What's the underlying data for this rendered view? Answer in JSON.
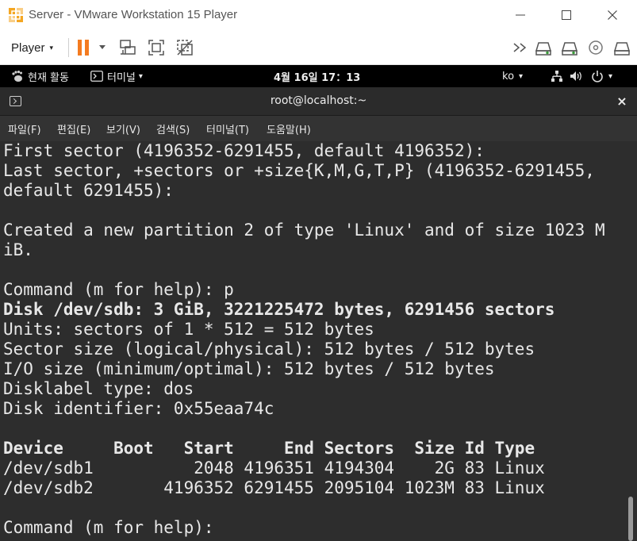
{
  "window": {
    "title": "Server - VMware Workstation 15 Player",
    "minimize_symbol": "—",
    "maximize_symbol": "☐",
    "close_symbol": "✕"
  },
  "toolbar": {
    "player_label": "Player",
    "caret": "▾",
    "icons": [
      "pause-icon",
      "send-ctrl-alt-del-icon",
      "fullscreen-icon",
      "unity-icon",
      "forward-icon",
      "hdd-icon",
      "network-icon",
      "cd-icon",
      "usb-icon"
    ]
  },
  "gnome": {
    "activities": "현재 활동",
    "terminal_menu": "터미널",
    "clock": "4월 16일  17：13",
    "input_method": "ko",
    "caret": "▾"
  },
  "terminal": {
    "title": "root@localhost:~",
    "close_symbol": "×",
    "menu": [
      "파일(F)",
      "편집(E)",
      "보기(V)",
      "검색(S)",
      "터미널(T)",
      "도움말(H)"
    ],
    "lines": [
      {
        "text": "First sector (4196352-6291455, default 4196352):",
        "bold": false
      },
      {
        "text": "Last sector, +sectors or +size{K,M,G,T,P} (4196352-6291455,",
        "bold": false
      },
      {
        "text": "default 6291455):",
        "bold": false
      },
      {
        "text": "",
        "bold": false
      },
      {
        "text": "Created a new partition 2 of type 'Linux' and of size 1023 M",
        "bold": false
      },
      {
        "text": "iB.",
        "bold": false
      },
      {
        "text": "",
        "bold": false
      },
      {
        "text": "Command (m for help): p",
        "bold": false
      },
      {
        "text": "Disk /dev/sdb: 3 GiB, 3221225472 bytes, 6291456 sectors",
        "bold": true
      },
      {
        "text": "Units: sectors of 1 * 512 = 512 bytes",
        "bold": false
      },
      {
        "text": "Sector size (logical/physical): 512 bytes / 512 bytes",
        "bold": false
      },
      {
        "text": "I/O size (minimum/optimal): 512 bytes / 512 bytes",
        "bold": false
      },
      {
        "text": "Disklabel type: dos",
        "bold": false
      },
      {
        "text": "Disk identifier: 0x55eaa74c",
        "bold": false
      },
      {
        "text": "",
        "bold": false
      },
      {
        "text": "Device     Boot   Start     End Sectors  Size Id Type",
        "bold": true
      },
      {
        "text": "/dev/sdb1          2048 4196351 4194304    2G 83 Linux",
        "bold": false
      },
      {
        "text": "/dev/sdb2       4196352 6291455 2095104 1023M 83 Linux",
        "bold": false
      },
      {
        "text": "",
        "bold": false
      },
      {
        "text": "Command (m for help): ",
        "bold": false
      }
    ]
  },
  "colors": {
    "terminal_bg": "#2d2d2d",
    "terminal_fg": "#e8e8e8",
    "pause_accent": "#f47b20",
    "gnome_bar": "#000000"
  }
}
